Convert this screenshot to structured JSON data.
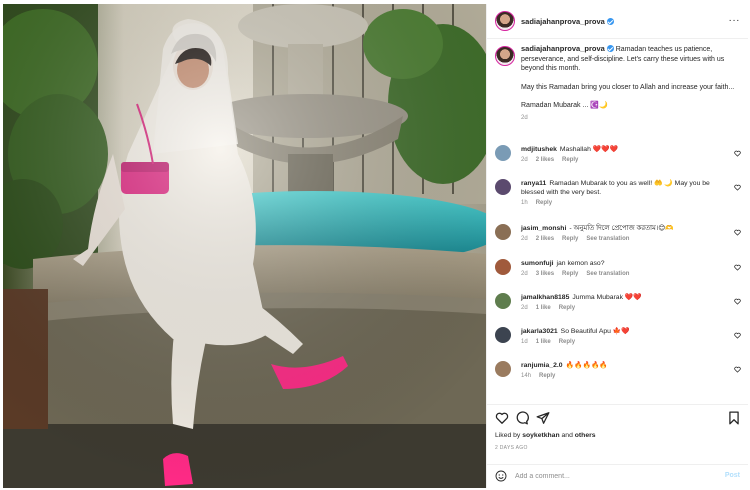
{
  "post": {
    "username": "sadiajahanprova_prova",
    "more_label": "···",
    "caption": {
      "username": "sadiajahanprova_prova",
      "line1": "Ramadan teaches us patience, perseverance, and self-discipline. Let's carry these virtues with us beyond this month.",
      "line2": "May this Ramadan bring you closer to Allah and increase your faith...",
      "line3": "Ramadan Mubarak ... ☪️🌙",
      "time": "2d"
    },
    "comments": [
      {
        "user": "mdjitushek",
        "text": "Mashallah ❤️❤️❤️",
        "time": "2d",
        "likes": "2 likes",
        "reply": "Reply",
        "translation": "",
        "avatar_color": "#7a9bb5"
      },
      {
        "user": "ranya11",
        "text": "Ramadan Mubarak to you as well! 🤲 🌙 May you be blessed with the very best.",
        "time": "1h",
        "likes": "",
        "reply": "Reply",
        "translation": "",
        "avatar_color": "#5b4a6e"
      },
      {
        "user": "jasim_monshi",
        "text": "- অনুমতি দিলে প্রেপোজ করতাম।😊🫶",
        "time": "2d",
        "likes": "2 likes",
        "reply": "Reply",
        "translation": "See translation",
        "avatar_color": "#8a6f55"
      },
      {
        "user": "sumonfuji",
        "text": "jan kemon aso?",
        "time": "2d",
        "likes": "3 likes",
        "reply": "Reply",
        "translation": "See translation",
        "avatar_color": "#a05a3c"
      },
      {
        "user": "jamalkhan8185",
        "text": "Jumma Mubarak ❤️❤️",
        "time": "2d",
        "likes": "1 like",
        "reply": "Reply",
        "translation": "",
        "avatar_color": "#5f7d4e"
      },
      {
        "user": "jakarla3021",
        "text": "So Beautiful Apu 🍁❤️",
        "time": "1d",
        "likes": "1 like",
        "reply": "Reply",
        "translation": "",
        "avatar_color": "#3c4450"
      },
      {
        "user": "ranjumia_2.0",
        "text": "🔥🔥🔥🔥🔥",
        "time": "14h",
        "likes": "",
        "reply": "Reply",
        "translation": "",
        "avatar_color": "#9a7b5f"
      }
    ],
    "liked_by_prefix": "Liked by",
    "liked_by_user": "soyketkhan",
    "liked_by_and": "and",
    "liked_by_others": "others",
    "posted_ago": "2 DAYS AGO",
    "add_comment_placeholder": "Add a comment...",
    "post_label": "Post"
  },
  "icons": {
    "like": "heart-icon",
    "comment": "comment-icon",
    "share": "share-icon",
    "save": "bookmark-icon",
    "emoji": "emoji-icon",
    "comment_like": "heart-icon"
  },
  "colors": {
    "verified": "#3897f0",
    "post_button": "#b2dffc",
    "secondary_text": "#8e8e8e",
    "primary_text": "#262626"
  }
}
